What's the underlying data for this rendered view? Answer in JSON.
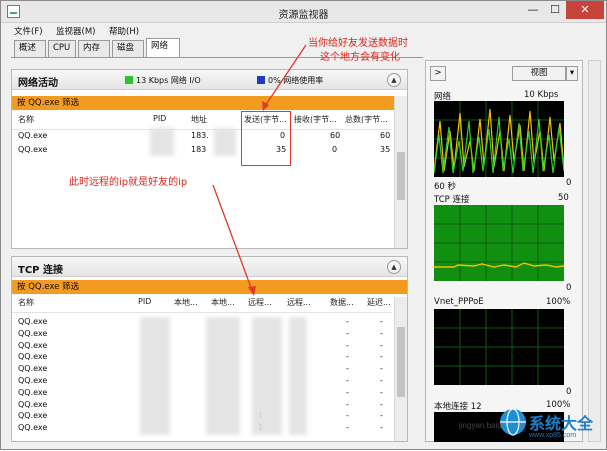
{
  "window": {
    "title": "资源监视器"
  },
  "window_buttons": {
    "minimize": "—",
    "maximize": "☐",
    "close": "✕"
  },
  "menu": [
    "文件(F)",
    "监视器(M)",
    "帮助(H)"
  ],
  "tabs": [
    "概述",
    "CPU",
    "内存",
    "磁盘",
    "网络"
  ],
  "active_tab": "网络",
  "network_activity": {
    "title": "网络活动",
    "legend_io": "13 Kbps 网络 I/O",
    "legend_usage": "0% 网络使用率",
    "legend_io_color": "#2cc32c",
    "legend_usage_color": "#1b3fbf",
    "filter": "按 QQ.exe 筛选",
    "columns": [
      "名称",
      "PID",
      "地址",
      "发送(字节...",
      "接收(字节...",
      "总数(字节..."
    ],
    "rows": [
      {
        "name": "QQ.exe",
        "pid": "",
        "address": "183.",
        "send": "0",
        "recv": "60",
        "total": "60"
      },
      {
        "name": "QQ.exe",
        "pid": "",
        "address": "183",
        "send": "35",
        "recv": "0",
        "total": "35"
      }
    ]
  },
  "tcp": {
    "title": "TCP 连接",
    "filter": "按 QQ.exe 筛选",
    "columns": [
      "名称",
      "PID",
      "本地...",
      "本地...",
      "远程...",
      "远程...",
      "数据...",
      "延迟..."
    ],
    "rows": [
      {
        "name": "QQ.exe",
        "v1": "-",
        "v2": "-",
        "extra": ""
      },
      {
        "name": "QQ.exe",
        "v1": "-",
        "v2": "-",
        "extra": ""
      },
      {
        "name": "QQ.exe",
        "v1": "-",
        "v2": "-",
        "extra": ""
      },
      {
        "name": "QQ.exe",
        "v1": "-",
        "v2": "-",
        "extra": ""
      },
      {
        "name": "QQ.exe",
        "v1": "-",
        "v2": "-",
        "extra": ""
      },
      {
        "name": "QQ.exe",
        "v1": "-",
        "v2": "-",
        "extra": ""
      },
      {
        "name": "QQ.exe",
        "v1": "-",
        "v2": "-",
        "extra": ""
      },
      {
        "name": "QQ.exe",
        "v1": "-",
        "v2": "-",
        "extra": ""
      },
      {
        "name": "QQ.exe",
        "v1": "-",
        "v2": "-",
        "extra": "1"
      },
      {
        "name": "QQ.exe",
        "v1": "-",
        "v2": "-",
        "extra": "1"
      }
    ]
  },
  "right_panel": {
    "view_button": "视图",
    "expand_button": ">",
    "network_graph": {
      "label": "网络",
      "value": "10 Kbps",
      "footer_left": "60 秒",
      "footer_right": "0"
    },
    "tcp_graph": {
      "label": "TCP 连接",
      "value": "50",
      "footer_right": "0"
    },
    "vnet_graph": {
      "label": "Vnet_PPPoE",
      "value": "100%",
      "footer_right": "0"
    },
    "local_graph": {
      "label": "本地连接 12",
      "value": "100%"
    }
  },
  "annotations": {
    "top_line1": "当你给好友发送数据时",
    "top_line2": "这个地方会有变化",
    "middle": "此时远程的ip就是好友的ip"
  },
  "watermark": {
    "brand": "系统大全",
    "site": "www.xp85.com",
    "faint": "jingyan.baidu.com"
  }
}
